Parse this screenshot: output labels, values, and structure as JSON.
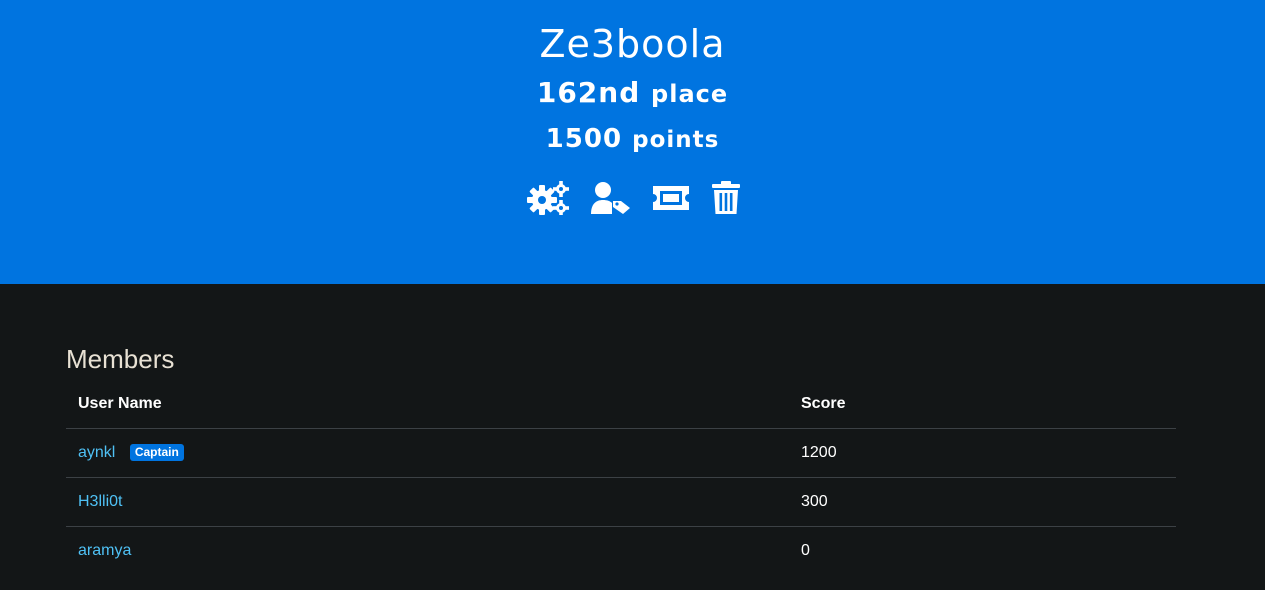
{
  "team": {
    "name": "Ze3boola",
    "place_number": "162nd",
    "place_suffix": "place",
    "points_number": "1500",
    "points_suffix": "points"
  },
  "actions": [
    {
      "icon": "gears-icon"
    },
    {
      "icon": "user-tag-icon"
    },
    {
      "icon": "ticket-icon"
    },
    {
      "icon": "trash-icon"
    }
  ],
  "members": {
    "title": "Members",
    "columns": {
      "user_name": "User Name",
      "score": "Score"
    },
    "rows": [
      {
        "name": "aynkl",
        "badge": "Captain",
        "score": "1200"
      },
      {
        "name": "H3lli0t",
        "badge": "",
        "score": "300"
      },
      {
        "name": "aramya",
        "badge": "",
        "score": "0"
      }
    ]
  },
  "colors": {
    "primary": "#0074e0",
    "background": "#131617",
    "link": "#4fc1f5"
  }
}
